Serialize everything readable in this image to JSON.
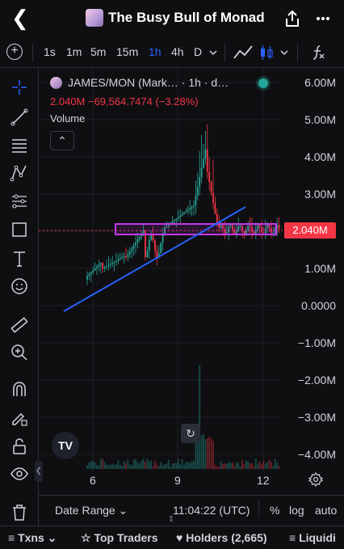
{
  "header": {
    "title": "The Busy Bull of Monad"
  },
  "toolbar": {
    "timeframes": [
      "1s",
      "1m",
      "5m",
      "15m",
      "1h",
      "4h",
      "D"
    ],
    "active_timeframe": "1h"
  },
  "legend": {
    "name": "JAMES/MON (Mark… · 1h · d…",
    "price_line": "2.040M  −69,564.7474 (−3.28%)",
    "volume_label": "Volume"
  },
  "price_axis": [
    "6.00M",
    "5.00M",
    "4.00M",
    "3.00M",
    "2.040M",
    "1.00M",
    "0.0000",
    "−1.00M",
    "−2.00M",
    "−3.00M",
    "−4.00M"
  ],
  "current_price_tag": "2.040M",
  "time_axis": [
    "6",
    "9",
    "12"
  ],
  "bottom_bar": {
    "date_range": "Date Range",
    "clock": "11:04:22 (UTC)",
    "percent": "%",
    "log": "log",
    "auto": "auto"
  },
  "tabs": {
    "txns": "Txns",
    "top_traders": "Top Traders",
    "holders": "Holders (2,665)",
    "liquidity": "Liquidi"
  },
  "colors": {
    "up": "#26a69a",
    "down": "#f23645",
    "accent": "#2962ff",
    "range_box": "#c239e6"
  },
  "chart_data": {
    "type": "candlestick",
    "x_ticks": [
      "6",
      "9",
      "12"
    ],
    "y_range": [
      -4000000,
      6000000
    ],
    "last_price": 2040000,
    "change": -69564.7474,
    "change_pct": -3.28
  }
}
